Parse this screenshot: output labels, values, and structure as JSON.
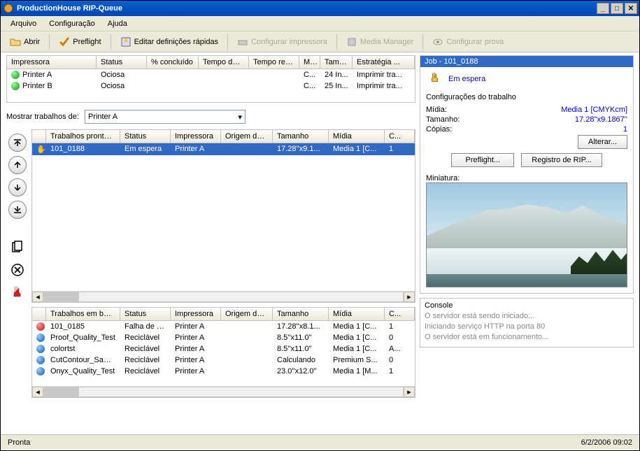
{
  "window": {
    "title": "ProductionHouse RIP-Queue"
  },
  "menu": {
    "file": "Arquivo",
    "config": "Configuração",
    "help": "Ajuda"
  },
  "toolbar": {
    "open": "Abrir",
    "preflight": "Preflight",
    "quickset": "Editar definições rápidas",
    "printer_cfg": "Configurar impressora",
    "media_mgr": "Media Manager",
    "proof_cfg": "Configurar prova"
  },
  "printers": {
    "headers": {
      "printer": "Impressora",
      "status": "Status",
      "pct": "% concluído",
      "elapsed": "Tempo dec...",
      "remaining": "Tempo rest...",
      "m": "M...",
      "size": "Tama...",
      "strategy": "Estratégia ..."
    },
    "rows": [
      {
        "name": "Printer A",
        "status": "Ociosa",
        "m": "C...",
        "size": "24 In...",
        "strategy": "Imprimir tra..."
      },
      {
        "name": "Printer B",
        "status": "Ociosa",
        "m": "C...",
        "size": "25 In...",
        "strategy": "Imprimir tra..."
      }
    ]
  },
  "filter": {
    "label": "Mostrar trabalhos de:",
    "value": "Printer A"
  },
  "ready": {
    "headers": {
      "name": "Trabalhos prontos p...",
      "status": "Status",
      "printer": "Impressora",
      "origin": "Origem da ...",
      "size": "Tamanho",
      "media": "Mídia",
      "copies": "C..."
    },
    "rows": [
      {
        "name": "101_0188",
        "status": "Em espera",
        "printer": "Printer A",
        "size": "17.28''x9.1...",
        "media": "Media 1 [C...",
        "copies": "1"
      }
    ]
  },
  "buffer": {
    "headers": {
      "name": "Trabalhos em buffer",
      "status": "Status",
      "printer": "Impressora",
      "origin": "Origem da ...",
      "size": "Tamanho",
      "media": "Mídia",
      "copies": "C..."
    },
    "rows": [
      {
        "icon": "error",
        "name": "101_0185",
        "status": "Falha de RIP",
        "printer": "Printer A",
        "size": "17.28''x8.1...",
        "media": "Media 1 [C...",
        "copies": "1"
      },
      {
        "icon": "ok",
        "name": "Proof_Quality_Test",
        "status": "Reciclável",
        "printer": "Printer A",
        "size": "8.5''x11.0''",
        "media": "Media 1 [C...",
        "copies": "0"
      },
      {
        "icon": "ok",
        "name": "colortst",
        "status": "Reciclável",
        "printer": "Printer A",
        "size": "8.5''x11.0''",
        "media": "Media 1 [C...",
        "copies": "A..."
      },
      {
        "icon": "ok",
        "name": "CutContour_Sample",
        "status": "Reciclável",
        "printer": "Printer A",
        "size": "Calculando",
        "media": "Premium S...",
        "copies": "0"
      },
      {
        "icon": "ok",
        "name": "Onyx_Quality_Test",
        "status": "Reciclável",
        "printer": "Printer A",
        "size": "23.0''x12.0''",
        "media": "Media 1 [M...",
        "copies": "1"
      }
    ]
  },
  "job": {
    "title": "Job - 101_0188",
    "wait": "Em espera",
    "section": "Configurações do trabalho",
    "media_label": "Mídia:",
    "media_value": "Media 1 [CMYKcm]",
    "size_label": "Tamanho:",
    "size_value": "17.28''x9.1867''",
    "copies_label": "Cópias:",
    "copies_value": "1",
    "change_btn": "Alterar...",
    "preflight_btn": "Preflight...",
    "riplog_btn": "Registro de RIP...",
    "thumb_label": "Miniatura:"
  },
  "console": {
    "title": "Console",
    "lines": [
      "O servidor está sendo iniciado...",
      "Iniciando serviço HTTP na porta 80",
      "O servidor está em funcionamento..."
    ]
  },
  "status": {
    "ready": "Pronta",
    "datetime": "6/2/2006  09:02"
  }
}
